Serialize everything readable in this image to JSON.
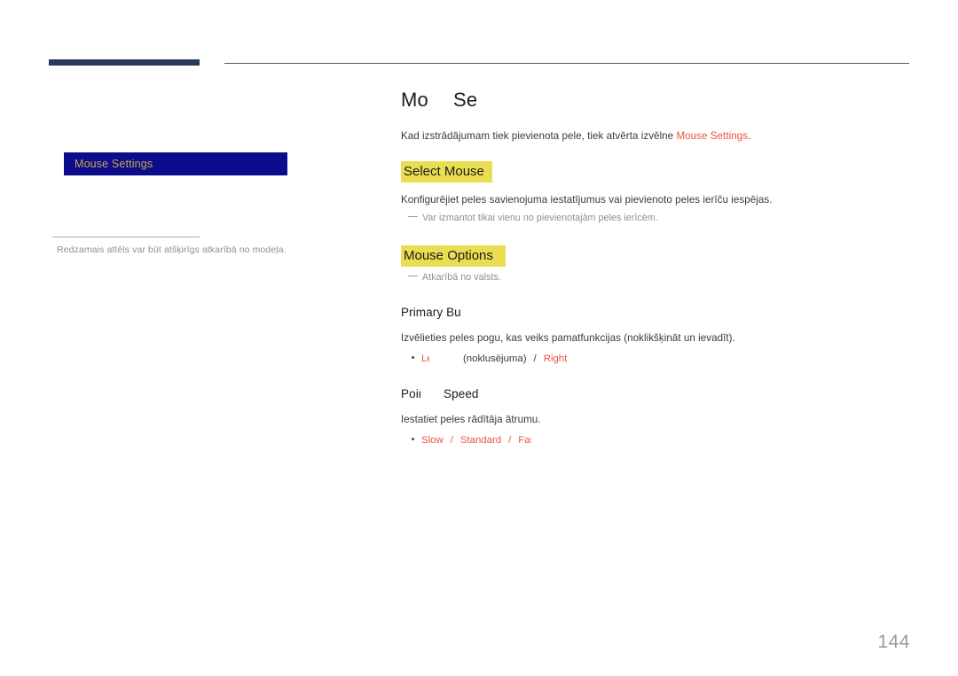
{
  "document": {
    "page_number": "144",
    "accent_color": "#e8543f",
    "highlight_color": "#e9dd51",
    "rule_color": "#2b3a5c",
    "menu_background": "#0c0c8c",
    "menu_text_color": "#c9a94a"
  },
  "sidebar": {
    "menu_item": {
      "label": "Mouse Settings",
      "name": "mouse-settings"
    },
    "caption": "Redzamais attēls var būt atšķirīgs atkarībā no modeļa."
  },
  "main": {
    "title": {
      "full": "Mouse Settings",
      "part1": "Mouse",
      "part2": "Settings"
    },
    "intro": {
      "text_before": "Kad izstrādājumam tiek pievienota pele, tiek atvērta izvēlne ",
      "link": "Mouse Settings",
      "text_after": "."
    },
    "sections": [
      {
        "heading": "Select Mouse",
        "description": "Konfigurējiet peles savienojuma iestatījumus vai pievienoto peles ierīču iespējas.",
        "note": "Var izmantot tikai vienu no pievienotajām peles ierīcēm."
      },
      {
        "heading": "Mouse Options",
        "note": "Atkarībā no valsts."
      }
    ],
    "subsections": [
      {
        "heading": "Primary Button",
        "heading_part1": "Primary",
        "heading_part2": "Button",
        "description": "Izvēlieties peles pogu, kas veiks pamatfunkcijas (noklikšķināt un ievadīt).",
        "options": {
          "first": "Left",
          "first_suffix": "(noklusējuma)",
          "separator": "/",
          "second": "Right"
        }
      },
      {
        "heading": "Pointer Speed",
        "heading_part1": "Pointer",
        "heading_part2": "Speed",
        "description": "Iestatiet peles rādītāja ātrumu.",
        "options": {
          "first": "Slow",
          "separator": "/",
          "second": "Standard",
          "third": "Fast"
        }
      }
    ]
  }
}
